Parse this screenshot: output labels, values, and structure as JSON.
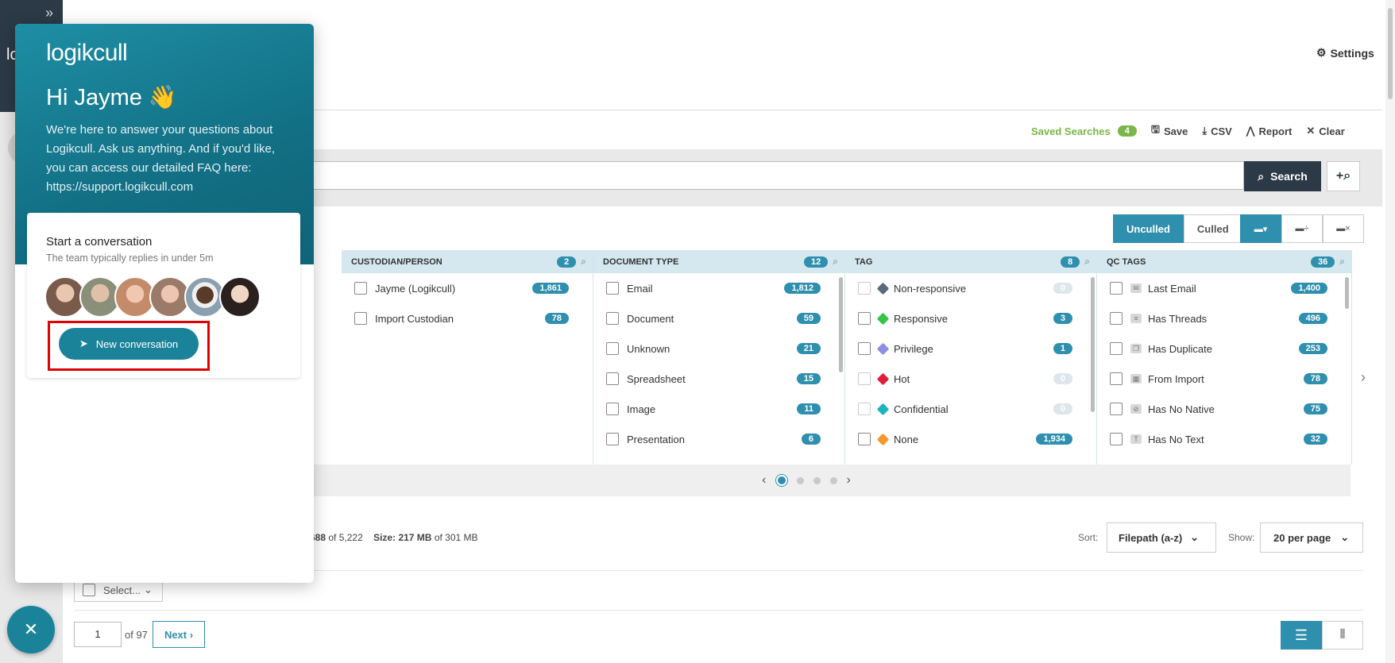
{
  "nav": {
    "expand_glyph": "»",
    "logo_peek": "lo"
  },
  "header": {
    "settings_label": "Settings",
    "settings_icon": "gear-icon"
  },
  "toolbar": {
    "saved_searches_label": "Saved Searches",
    "saved_searches_count": "4",
    "save_label": "Save",
    "csv_label": "CSV",
    "report_label": "Report",
    "clear_label": "Clear"
  },
  "search": {
    "button_label": "Search",
    "value": ""
  },
  "cull_toggle": {
    "unculled": "Unculled",
    "culled": "Culled"
  },
  "facets": [
    {
      "title": "CUSTODIAN/PERSON",
      "count": "2",
      "rows": [
        {
          "label": "Jayme (Logikcull)",
          "count": "1,861"
        },
        {
          "label": "Import Custodian",
          "count": "78"
        }
      ]
    },
    {
      "title": "DOCUMENT TYPE",
      "count": "12",
      "rows": [
        {
          "label": "Email",
          "count": "1,812"
        },
        {
          "label": "Document",
          "count": "59"
        },
        {
          "label": "Unknown",
          "count": "21"
        },
        {
          "label": "Spreadsheet",
          "count": "15"
        },
        {
          "label": "Image",
          "count": "11"
        },
        {
          "label": "Presentation",
          "count": "6"
        }
      ]
    },
    {
      "title": "TAG",
      "count": "8",
      "rows": [
        {
          "label": "Non-responsive",
          "count": "0",
          "color": "#5b6b7a"
        },
        {
          "label": "Responsive",
          "count": "3",
          "color": "#37c24a"
        },
        {
          "label": "Privilege",
          "count": "1",
          "color": "#8e8ee6"
        },
        {
          "label": "Hot",
          "count": "0",
          "color": "#e0203a"
        },
        {
          "label": "Confidential",
          "count": "0",
          "color": "#1fb3c2"
        },
        {
          "label": "None",
          "count": "1,934",
          "color": "#f29a30"
        }
      ]
    },
    {
      "title": "QC TAGS",
      "count": "36",
      "rows": [
        {
          "label": "Last Email",
          "count": "1,400"
        },
        {
          "label": "Has Threads",
          "count": "496"
        },
        {
          "label": "Has Duplicate",
          "count": "253"
        },
        {
          "label": "From Import",
          "count": "78"
        },
        {
          "label": "Has No Native",
          "count": "75"
        },
        {
          "label": "Has No Text",
          "count": "32"
        }
      ]
    }
  ],
  "results": {
    "docs_shown": "688",
    "docs_of": "of 5,222",
    "size_label": "Size:",
    "size_value": "217 MB",
    "size_of": "of 301 MB",
    "sort_label": "Sort:",
    "sort_value": "Filepath (a-z)",
    "show_label": "Show:",
    "show_value": "20 per page",
    "select_label": "Select..."
  },
  "pagination": {
    "page": "1",
    "of_label": "of 97",
    "next_label": "Next ›"
  },
  "chat": {
    "logo": "logikcull",
    "greeting": "Hi Jayme 👋",
    "intro": "We're here to answer your questions about Logikcull. Ask us anything. And if you'd like, you can access our detailed FAQ here: https://support.logikcull.com",
    "card_title": "Start a conversation",
    "card_sub": "The team typically replies in under 5m",
    "new_conversation_label": "New conversation",
    "avatar_colors": [
      "#7a5a4a",
      "#8a8f7a",
      "#c48b6a",
      "#9b7a6a",
      "#3a2a22",
      "#4a3a3a"
    ],
    "close_glyph": "✕"
  }
}
